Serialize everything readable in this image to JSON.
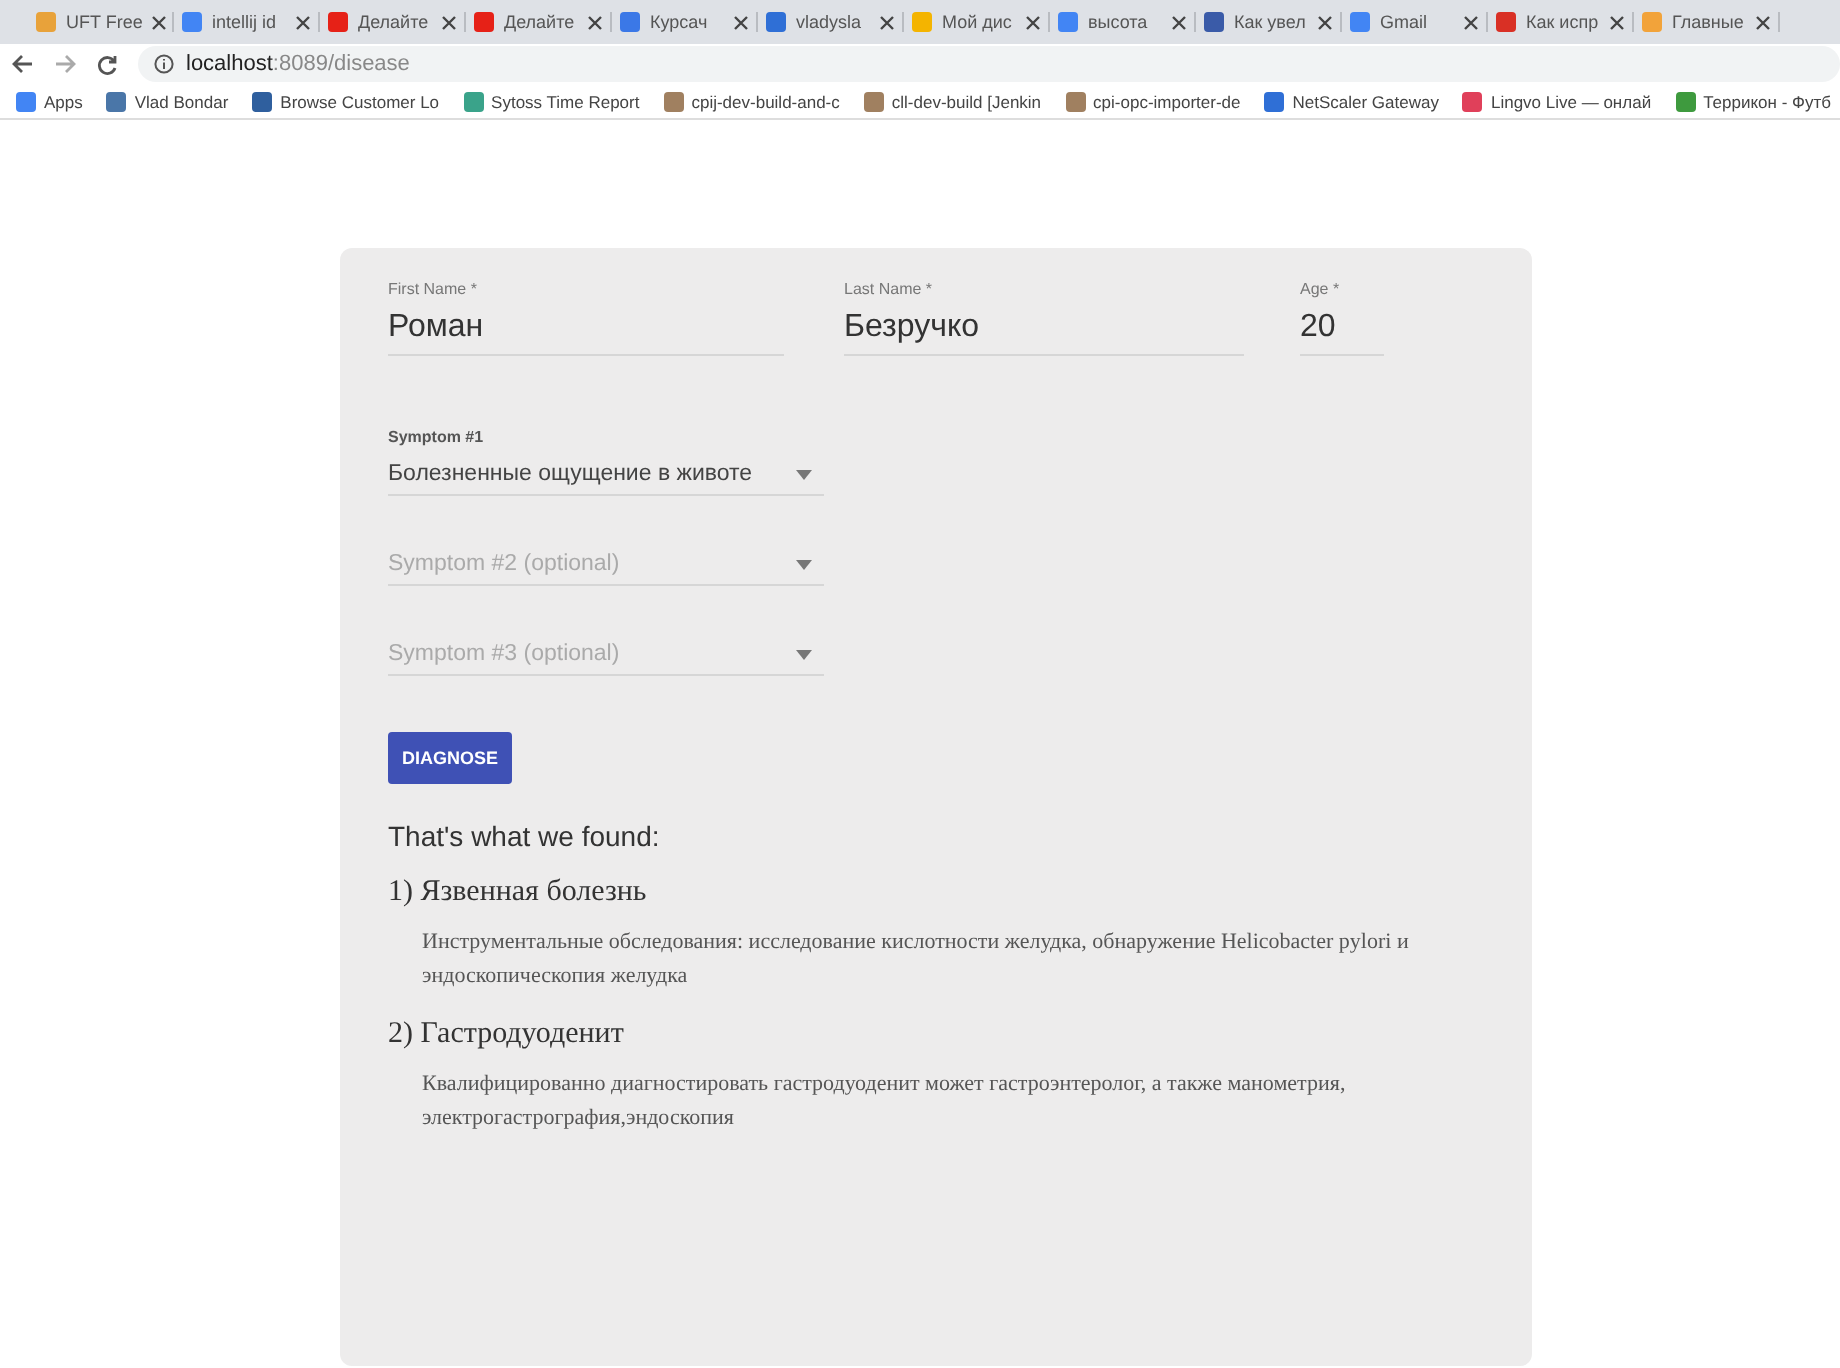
{
  "browser": {
    "tabs": [
      {
        "title": "UFT Free",
        "color": "#e8a23a"
      },
      {
        "title": "intellij id",
        "color": "#4285f4"
      },
      {
        "title": "Делайте",
        "color": "#e62117"
      },
      {
        "title": "Делайте",
        "color": "#e62117"
      },
      {
        "title": "Курсач",
        "color": "#3b78e7"
      },
      {
        "title": "vladysla",
        "color": "#2f6fd6"
      },
      {
        "title": "Мой дис",
        "color": "#f4b400"
      },
      {
        "title": "высота",
        "color": "#4285f4"
      },
      {
        "title": "Как увел",
        "color": "#3a5ba8"
      },
      {
        "title": "Gmail",
        "color": "#4285f4"
      },
      {
        "title": "Как испр",
        "color": "#d93025"
      },
      {
        "title": "Главные",
        "color": "#f2a33a"
      }
    ],
    "url_host": "localhost",
    "url_rest": ":8089/disease",
    "bookmarks": [
      {
        "title": "Apps",
        "color": "#4285f4"
      },
      {
        "title": "Vlad Bondar",
        "color": "#4a76a8"
      },
      {
        "title": "Browse Customer Lo",
        "color": "#2f5f9e"
      },
      {
        "title": "Sytoss Time Report",
        "color": "#3aa38a"
      },
      {
        "title": "cpij-dev-build-and-c",
        "color": "#a08060"
      },
      {
        "title": "cll-dev-build [Jenkin",
        "color": "#a08060"
      },
      {
        "title": "cpi-opc-importer-de",
        "color": "#a08060"
      },
      {
        "title": "NetScaler Gateway",
        "color": "#2f6fd6"
      },
      {
        "title": "Lingvo Live — онлай",
        "color": "#e0405a"
      },
      {
        "title": "Террикон - Футб",
        "color": "#3e9a3e"
      }
    ]
  },
  "form": {
    "fields": [
      {
        "label": "First Name *",
        "value": "Роман"
      },
      {
        "label": "Last Name *",
        "value": "Безручко"
      },
      {
        "label": "Age *",
        "value": "20"
      }
    ],
    "symptoms": [
      {
        "kind": "value",
        "label": "Symptom #1",
        "value": "Болезненные ощущение в животе"
      },
      {
        "kind": "placeholder",
        "placeholder": "Symptom #2 (optional)"
      },
      {
        "kind": "placeholder",
        "placeholder": "Symptom #3 (optional)"
      }
    ],
    "button": "DIAGNOSE"
  },
  "results": {
    "heading": "That's what we found:",
    "items": [
      {
        "title": "1) Язвенная болезнь",
        "text": "Инструментальные обследования: исследование кислотности желудка, обнаружение Helicobacter pylori и эндоскопическопия желудка"
      },
      {
        "title": "2) Гастродуоденит",
        "text": "Квалифицированно диагностировать гастродуоденит может гастроэнтеролог, а также манометрия, электрогастрография,эндоскопия"
      }
    ]
  }
}
